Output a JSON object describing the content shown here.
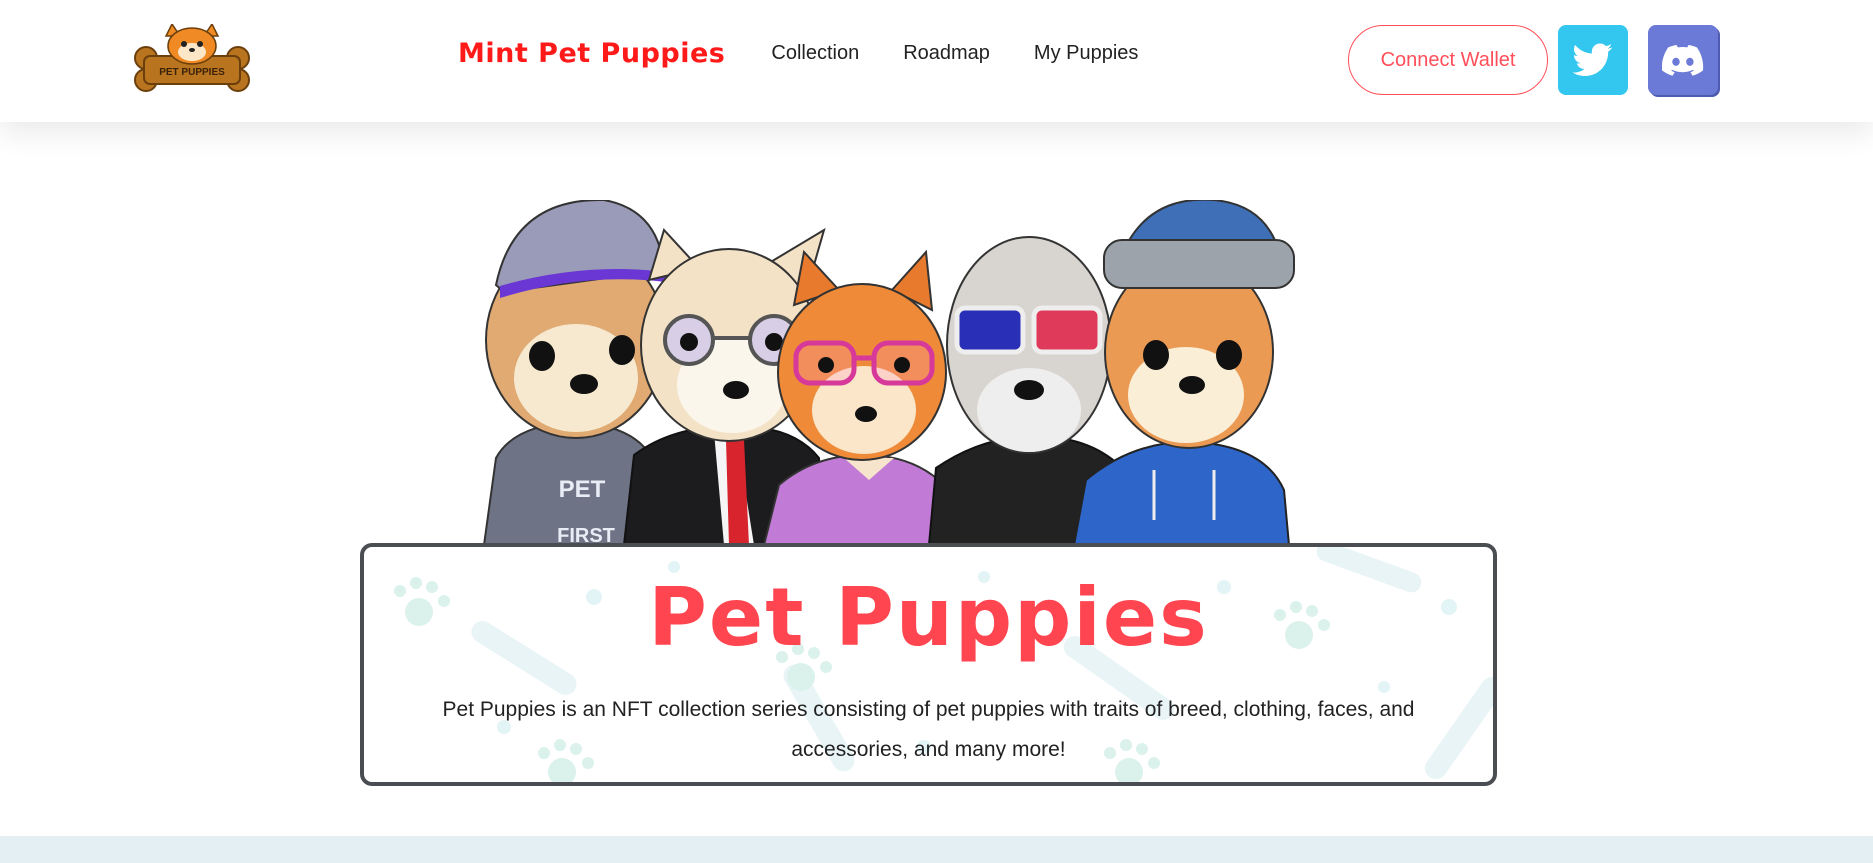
{
  "header": {
    "logo_text": "PET PUPPIES",
    "nav": [
      {
        "label": "Mint Pet Puppies",
        "active": true
      },
      {
        "label": "Collection",
        "active": false
      },
      {
        "label": "Roadmap",
        "active": false
      },
      {
        "label": "My Puppies",
        "active": false
      }
    ],
    "connect_wallet_label": "Connect Wallet",
    "social": [
      {
        "name": "twitter-icon",
        "color": "#33c6ee"
      },
      {
        "name": "discord-icon",
        "color": "#6b7ad6"
      }
    ]
  },
  "hero": {
    "shirt_text_line1": "PET",
    "shirt_text_line2": "FIRST",
    "title": "Pet Puppies",
    "description": "Pet Puppies is an NFT collection series consisting of pet puppies with traits of breed, clothing, faces, and accessories, and many more!"
  },
  "colors": {
    "accent": "#ff4650",
    "nav_active": "#ff1a1a",
    "card_border": "#4a4d52",
    "band": "#e3eff2"
  }
}
